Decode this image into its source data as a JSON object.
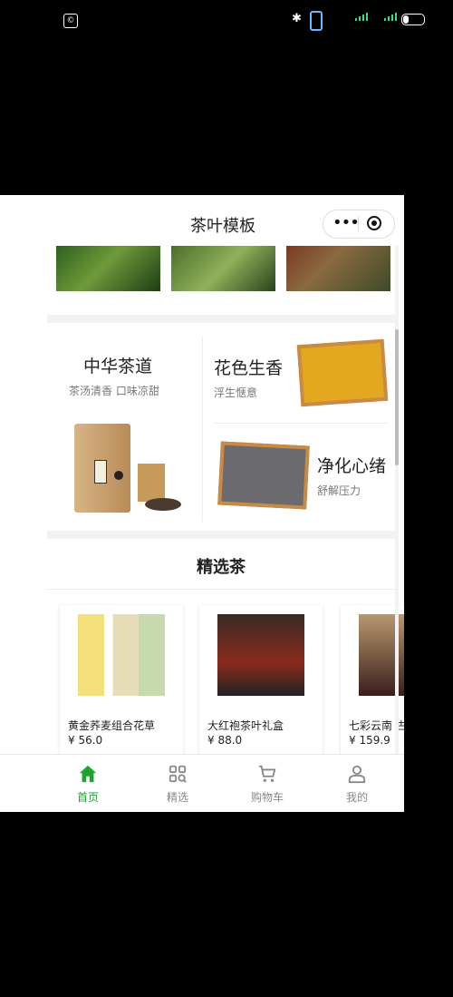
{
  "status_bar": {
    "notification_badge": "©"
  },
  "navbar": {
    "title": "茶叶模板"
  },
  "categories": [
    {
      "heading": "中华茶道",
      "subtitle": "茶汤清香  口味凉甜"
    },
    {
      "heading": "花色生香",
      "subtitle": "浮生惬意"
    },
    {
      "heading": "净化心绪",
      "subtitle": "舒解压力"
    }
  ],
  "featured": {
    "title": "精选茶",
    "products": [
      {
        "name": "黄金荞麦组合花草",
        "price": "¥ 56.0"
      },
      {
        "name": "大红袍茶叶礼盒",
        "price": "¥ 88.0"
      },
      {
        "name": "七彩云南 古",
        "price": "¥ 159.9"
      }
    ]
  },
  "tabbar": {
    "items": [
      {
        "label": "首页",
        "icon": "home-icon",
        "active": true
      },
      {
        "label": "精选",
        "icon": "grid-icon",
        "active": false
      },
      {
        "label": "购物车",
        "icon": "cart-icon",
        "active": false
      },
      {
        "label": "我的",
        "icon": "user-icon",
        "active": false
      }
    ]
  },
  "colors": {
    "accent": "#1aa62c",
    "text": "#222222",
    "muted": "#888888"
  }
}
